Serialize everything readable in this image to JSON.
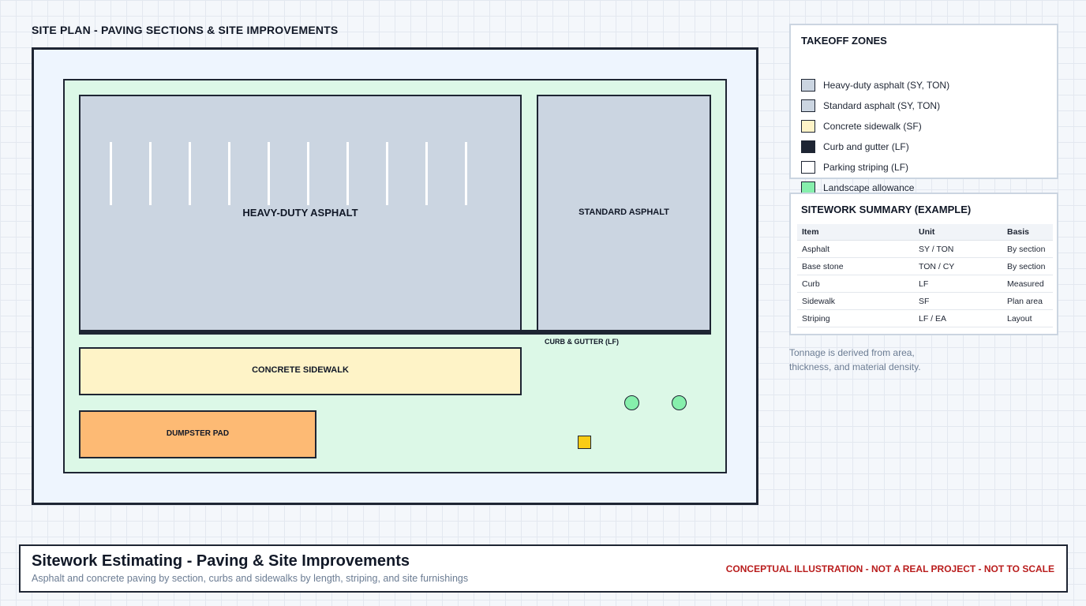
{
  "plan": {
    "title": "SITE PLAN - PAVING SECTIONS & SITE IMPROVEMENTS",
    "labels": {
      "heavy_duty": "HEAVY-DUTY ASPHALT",
      "standard": "STANDARD ASPHALT",
      "curb": "CURB & GUTTER (LF)",
      "sidewalk": "CONCRETE SIDEWALK",
      "dumpster": "DUMPSTER PAD"
    },
    "parking_stripe_count": 10,
    "colors": {
      "asphalt": "#cbd5e1",
      "sidewalk": "#fef3c7",
      "dumpster": "#fdba74",
      "landscape": "#dcf8e7",
      "curb": "#1e2533",
      "tree": "#86efac",
      "furnishing": "#facc15"
    }
  },
  "legend": {
    "title": "TAKEOFF ZONES",
    "items": [
      {
        "label": "Heavy-duty asphalt (SY, TON)",
        "color": "#cbd5e1"
      },
      {
        "label": "Standard asphalt (SY, TON)",
        "color": "#cbd5e1"
      },
      {
        "label": "Concrete sidewalk (SF)",
        "color": "#fef3c7"
      },
      {
        "label": "Curb and gutter (LF)",
        "color": "#1e2533"
      },
      {
        "label": "Parking striping (LF)",
        "color": "#ffffff"
      },
      {
        "label": "Landscape allowance",
        "color": "#86efac"
      }
    ]
  },
  "summary": {
    "title": "SITEWORK SUMMARY (EXAMPLE)",
    "headers": [
      "Item",
      "Unit",
      "Basis"
    ],
    "rows": [
      [
        "Asphalt",
        "SY / TON",
        "By section"
      ],
      [
        "Base stone",
        "TON / CY",
        "By section"
      ],
      [
        "Curb",
        "LF",
        "Measured"
      ],
      [
        "Sidewalk",
        "SF",
        "Plan area"
      ],
      [
        "Striping",
        "LF / EA",
        "Layout"
      ]
    ]
  },
  "note": {
    "line1": "Tonnage is derived from area,",
    "line2": "thickness, and material density."
  },
  "footer": {
    "title": "Sitework Estimating - Paving & Site Improvements",
    "subtitle": "Asphalt and concrete paving by section, curbs and sidewalks by length, striping, and site furnishings",
    "warning": "CONCEPTUAL ILLUSTRATION - NOT A REAL PROJECT - NOT TO SCALE"
  }
}
